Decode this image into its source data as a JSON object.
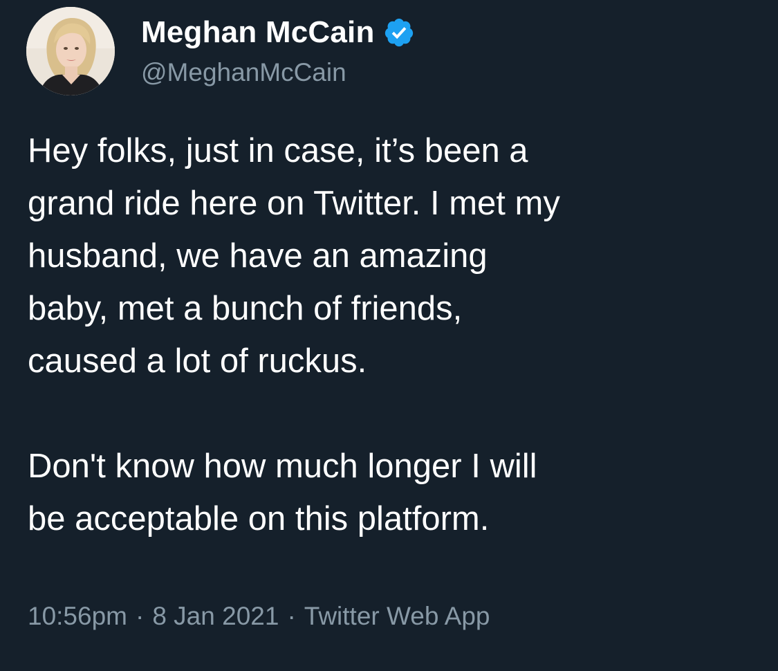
{
  "author": {
    "display_name": "Meghan McCain",
    "handle": "@MeghanMcCain",
    "verified": true,
    "verified_icon": "verified-badge-icon"
  },
  "tweet": {
    "paragraphs": [
      "Hey folks, just in case, it’s been a\ngrand ride here on Twitter. I met my\nhusband, we have an amazing\nbaby, met a bunch of friends,\ncaused a lot of ruckus.",
      "Don't know how much longer I will\nbe acceptable on this platform."
    ],
    "time": "10:56pm",
    "date": "8 Jan 2021",
    "separator": "·",
    "source": "Twitter Web App"
  },
  "colors": {
    "background": "#15202b",
    "text": "#ffffff",
    "secondary_text": "#8899a6",
    "verified_blue": "#1da1f2"
  }
}
